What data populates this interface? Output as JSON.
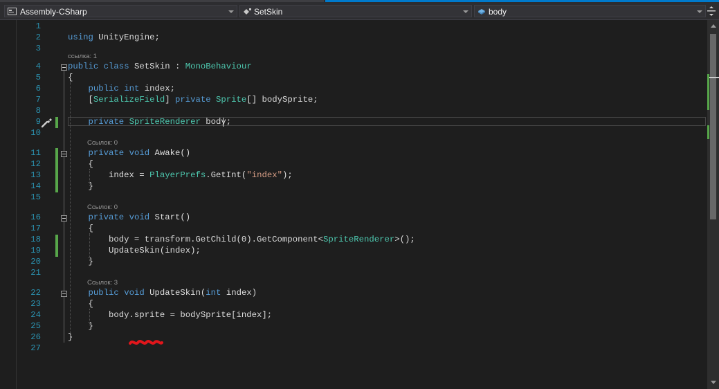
{
  "navbar": {
    "project": "Assembly-CSharp",
    "type": "SetSkin",
    "member": "body"
  },
  "lens": {
    "class_refs": "ссылка: 1",
    "awake_refs": "Ссылок: 0",
    "start_refs": "Ссылок: 0",
    "updateskin_refs": "Ссылок: 3"
  },
  "lines": [
    {
      "n": "1",
      "code": ""
    },
    {
      "n": "2",
      "code": "using UnityEngine;"
    },
    {
      "n": "3",
      "code": ""
    },
    {
      "n": "4",
      "code": "public class SetSkin : MonoBehaviour"
    },
    {
      "n": "5",
      "code": "{"
    },
    {
      "n": "6",
      "code": "    public int index;"
    },
    {
      "n": "7",
      "code": "    [SerializeField] private Sprite[] bodySprite;"
    },
    {
      "n": "8",
      "code": ""
    },
    {
      "n": "9",
      "code": "    private SpriteRenderer body;"
    },
    {
      "n": "10",
      "code": ""
    },
    {
      "n": "11",
      "code": "    private void Awake()"
    },
    {
      "n": "12",
      "code": "    {"
    },
    {
      "n": "13",
      "code": "        index = PlayerPrefs.GetInt(\"index\");"
    },
    {
      "n": "14",
      "code": "    }"
    },
    {
      "n": "15",
      "code": ""
    },
    {
      "n": "16",
      "code": "    private void Start()"
    },
    {
      "n": "17",
      "code": "    {"
    },
    {
      "n": "18",
      "code": "        body = transform.GetChild(0).GetComponent<SpriteRenderer>();"
    },
    {
      "n": "19",
      "code": "        UpdateSkin(index);"
    },
    {
      "n": "20",
      "code": "    }"
    },
    {
      "n": "21",
      "code": ""
    },
    {
      "n": "22",
      "code": "    public void UpdateSkin(int index)"
    },
    {
      "n": "23",
      "code": "    {"
    },
    {
      "n": "24",
      "code": "        body.sprite = bodySprite[index];"
    },
    {
      "n": "25",
      "code": "    }"
    },
    {
      "n": "26",
      "code": "}"
    },
    {
      "n": "27",
      "code": ""
    }
  ],
  "colors": {
    "keyword": "#569cd6",
    "type": "#4ec9b0",
    "string": "#d69d85",
    "line_number": "#2b91af",
    "change_bar": "#57a64a"
  }
}
